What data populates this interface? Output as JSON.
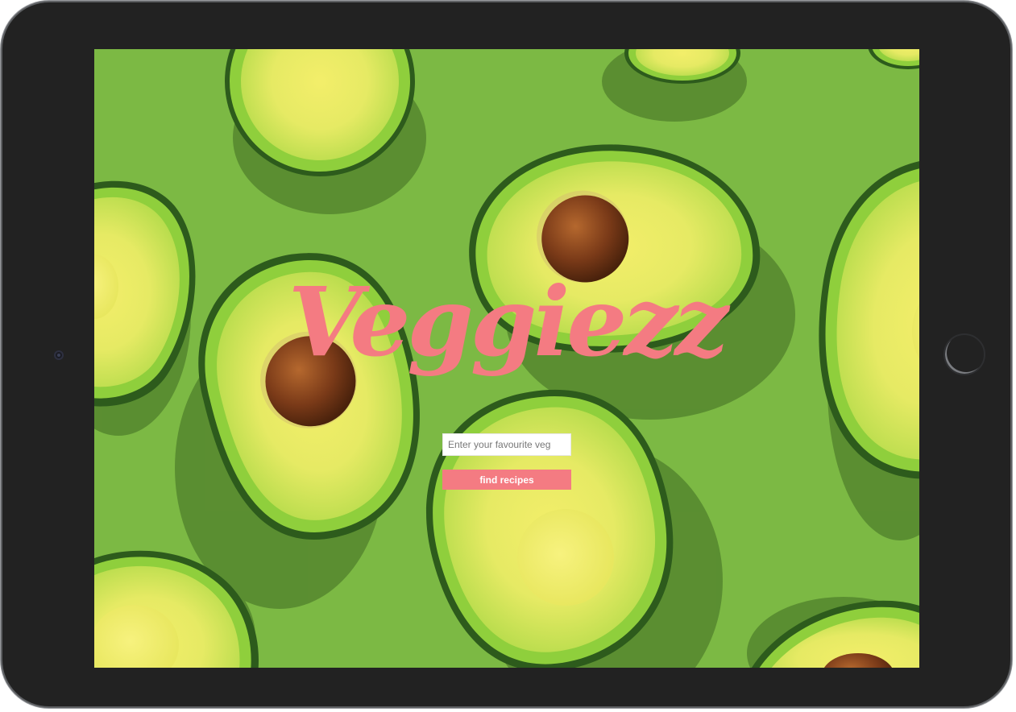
{
  "app": {
    "logo_text": "Veggiezz"
  },
  "search": {
    "placeholder": "Enter your favourite veg",
    "value": ""
  },
  "actions": {
    "find_label": "find recipes"
  },
  "colors": {
    "accent": "#f47b82",
    "background": "#7cb944",
    "bezel": "#222222"
  },
  "icons": {
    "camera": "camera-icon",
    "home": "home-button-icon"
  }
}
